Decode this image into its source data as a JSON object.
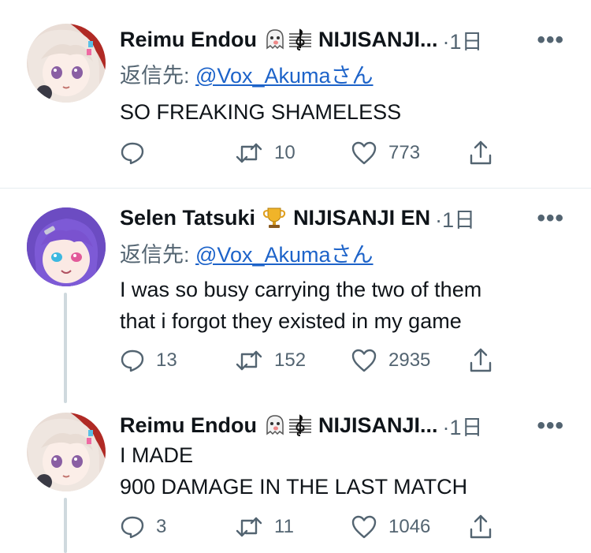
{
  "tweets": [
    {
      "name": "Reimu Endou",
      "emoji": [
        "ghost",
        "treble-clef"
      ],
      "affiliation": "NIJISANJI...",
      "time": "·1日",
      "reply_prefix": "返信先: ",
      "reply_handle": "@Vox_Akumaさん",
      "text": "SO FREAKING SHAMELESS",
      "replies": "",
      "retweets": "10",
      "likes": "773"
    },
    {
      "name": "Selen Tatsuki",
      "emoji": [
        "trophy"
      ],
      "affiliation": "NIJISANJI EN",
      "time": "·1日",
      "reply_prefix": "返信先: ",
      "reply_handle": "@Vox_Akumaさん",
      "text": "I was so busy carrying the two of them\nthat i forgot they existed in my game",
      "replies": "13",
      "retweets": "152",
      "likes": "2935"
    },
    {
      "name": "Reimu Endou",
      "emoji": [
        "ghost",
        "treble-clef"
      ],
      "affiliation": "NIJISANJI...",
      "time": "·1日",
      "text": "I MADE\n900 DAMAGE IN THE LAST MATCH",
      "replies": "3",
      "retweets": "11",
      "likes": "1046"
    }
  ],
  "colors": {
    "secondary": "#536471",
    "link": "#1d63c9",
    "thread": "#cfd9de"
  }
}
